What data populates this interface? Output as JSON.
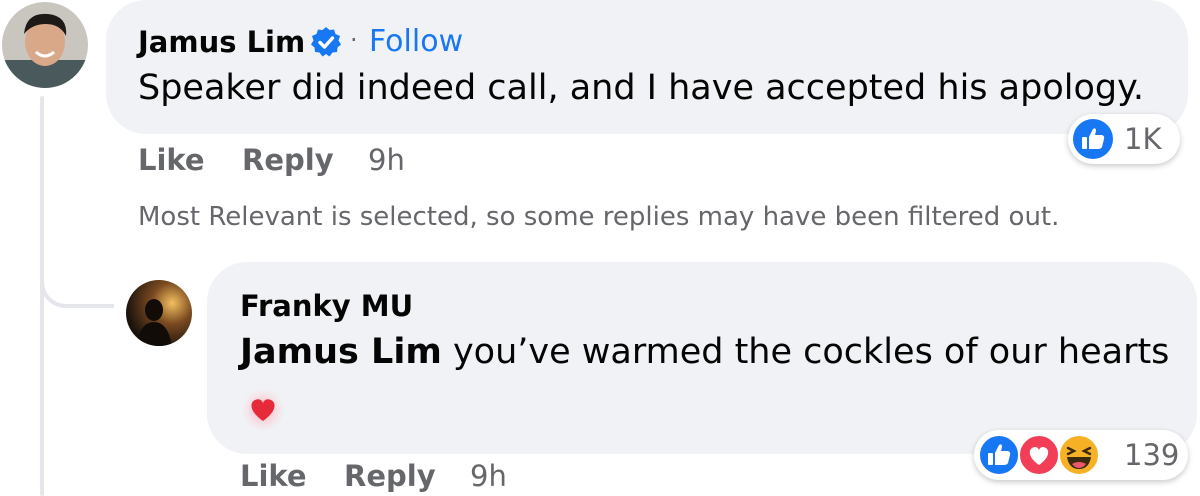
{
  "comment": {
    "author": "Jamus Lim",
    "verified_icon": "verified-badge-icon",
    "separator": "·",
    "follow_label": "Follow",
    "text": "Speaker did indeed call, and I have accepted his apology.",
    "actions": {
      "like": "Like",
      "reply": "Reply",
      "time": "9h"
    },
    "reactions": {
      "icons": [
        "like-reaction-icon"
      ],
      "count": "1K"
    }
  },
  "filter_note": "Most Relevant is selected, so some replies may have been filtered out.",
  "reply": {
    "author": "Franky MU",
    "mention": "Jamus Lim",
    "text": " you’ve warmed the cockles of our hearts",
    "emoji": "red-heart-emoji",
    "actions": {
      "like": "Like",
      "reply": "Reply",
      "time": "9h"
    },
    "reactions": {
      "icons": [
        "like-reaction-icon",
        "love-reaction-icon",
        "haha-reaction-icon"
      ],
      "count": "139"
    }
  },
  "colors": {
    "bubble": "#f0f2f5",
    "link": "#1877f2",
    "muted": "#65676b",
    "like_blue": "#1877f2",
    "love_red": "#f33e58",
    "haha_yellow": "#f7b125"
  }
}
